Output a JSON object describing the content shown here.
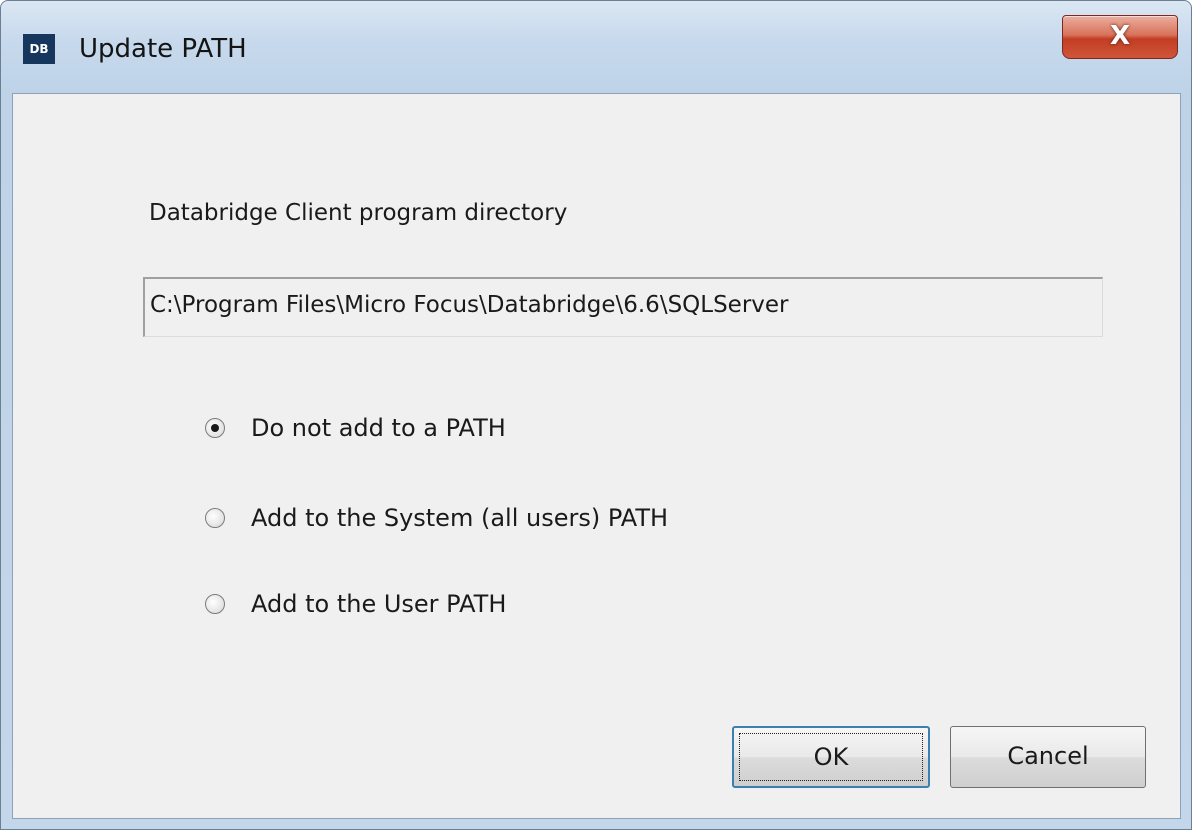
{
  "window": {
    "title": "Update PATH",
    "icon_text": "DB",
    "close_glyph": "X"
  },
  "directory": {
    "label": "Databridge Client program directory",
    "value": "C:\\Program Files\\Micro Focus\\Databridge\\6.6\\SQLServer"
  },
  "path_options": [
    {
      "label": "Do not add to a PATH",
      "selected": true
    },
    {
      "label": "Add to the System (all users) PATH",
      "selected": false
    },
    {
      "label": "Add to the User PATH",
      "selected": false
    }
  ],
  "buttons": {
    "ok_label": "OK",
    "cancel_label": "Cancel"
  },
  "icons": [
    "db-app-icon",
    "close-icon",
    "radio-icon"
  ],
  "colors": {
    "accent": "#3c7fb1",
    "close_button": "#c23d23",
    "icon_background": "#16365e"
  }
}
